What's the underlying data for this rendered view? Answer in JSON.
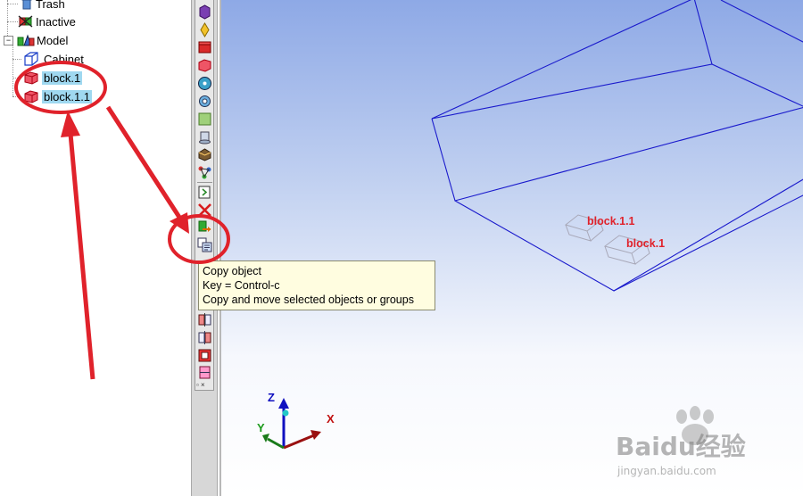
{
  "tree": {
    "items": [
      {
        "label": "Trash",
        "icon": "trash-icon"
      },
      {
        "label": "Inactive",
        "icon": "inactive-icon"
      },
      {
        "label": "Model",
        "icon": "model-icon"
      },
      {
        "label": "Cabinet",
        "icon": "cabinet-icon"
      },
      {
        "label": "block.1",
        "icon": "block-icon",
        "selected": true
      },
      {
        "label": "block.1.1",
        "icon": "block-icon",
        "selected": true
      }
    ]
  },
  "tooltip": {
    "title": "Copy object",
    "key": "Key = Control-c",
    "description": "Copy and move selected objects or groups"
  },
  "viewport": {
    "labels": [
      "block.1.1",
      "block.1"
    ],
    "axes": {
      "z": "Z",
      "y": "Y",
      "x": "X"
    }
  },
  "watermark": {
    "brand": "Baidu经验",
    "url": "jingyan.baidu.com"
  },
  "colors": {
    "annotation_red": "#e0222b",
    "wire_blue": "#1a1acc",
    "selection": "#9fd8f0"
  }
}
